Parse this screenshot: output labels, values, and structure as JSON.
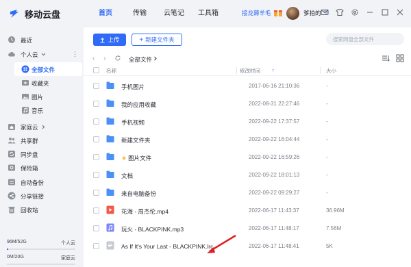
{
  "app": {
    "title": "移动云盘"
  },
  "nav": {
    "items": [
      "首页",
      "传输",
      "云笔记",
      "工具箱"
    ],
    "active_index": 0
  },
  "header": {
    "promo": "接龙薅羊毛",
    "username": "爹拍的"
  },
  "colors": {
    "accent": "#2f6bf6",
    "folder": "#4a90f5",
    "video_red": "#f15a4a",
    "audio_purple": "#7c86f7"
  },
  "sidebar": {
    "recent": "最近",
    "personal_cloud": "个人云",
    "all_files": "全部文件",
    "favorites": "收藏夹",
    "pictures": "图片",
    "music": "音乐",
    "family_cloud": "家庭云",
    "shared_group": "共享群",
    "sync_disk": "同步盘",
    "safe_box": "保险箱",
    "auto_backup": "自动备份",
    "share_links": "分享链接",
    "recycle_bin": "回收站",
    "quota_personal": {
      "used": "96M/52G",
      "label": "个人云",
      "fraction": 0.02
    },
    "quota_family": {
      "used": "0M/20G",
      "label": "家庭云",
      "fraction": 0.0
    }
  },
  "toolbar": {
    "upload": "上传",
    "new_folder": "新建文件夹",
    "search_placeholder": "搜索网盘全部文件"
  },
  "breadcrumb": {
    "path": "全部文件"
  },
  "table": {
    "columns": {
      "name": "名称",
      "modified": "修改时间",
      "size": "大小"
    },
    "sort_indicator": "↑",
    "rows": [
      {
        "type": "folder",
        "name": "手机图片",
        "date": "2017-06-16 21:10:36",
        "size": "-"
      },
      {
        "type": "folder",
        "name": "我的应用收藏",
        "date": "2022-08-31 22:27:46",
        "size": "-"
      },
      {
        "type": "folder",
        "name": "手机视频",
        "date": "2022-09-22 17:37:57",
        "size": "-"
      },
      {
        "type": "folder",
        "name": "新建文件夹",
        "date": "2022-09-22 16:04:44",
        "size": "-"
      },
      {
        "type": "folder",
        "name": "图片文件",
        "starred": true,
        "date": "2022-09-22 16:59:26",
        "size": "-"
      },
      {
        "type": "folder",
        "name": "文档",
        "date": "2022-09-22 18:01:13",
        "size": "-"
      },
      {
        "type": "folder",
        "name": "来自电脑备份",
        "date": "2022-09-22 09:29:27",
        "size": "-"
      },
      {
        "type": "video",
        "name": "花海 - 周杰伦.mp4",
        "date": "2022-06-17 11:43:37",
        "size": "36.96M"
      },
      {
        "type": "audio",
        "name": "玩火 - BLACKPINK.mp3",
        "date": "2022-06-17 11:48:17",
        "size": "7.56M"
      },
      {
        "type": "text",
        "name": "As If It's Your Last - BLACKPINK.lrc",
        "date": "2022-06-17 11:48:41",
        "size": "5K"
      }
    ]
  }
}
